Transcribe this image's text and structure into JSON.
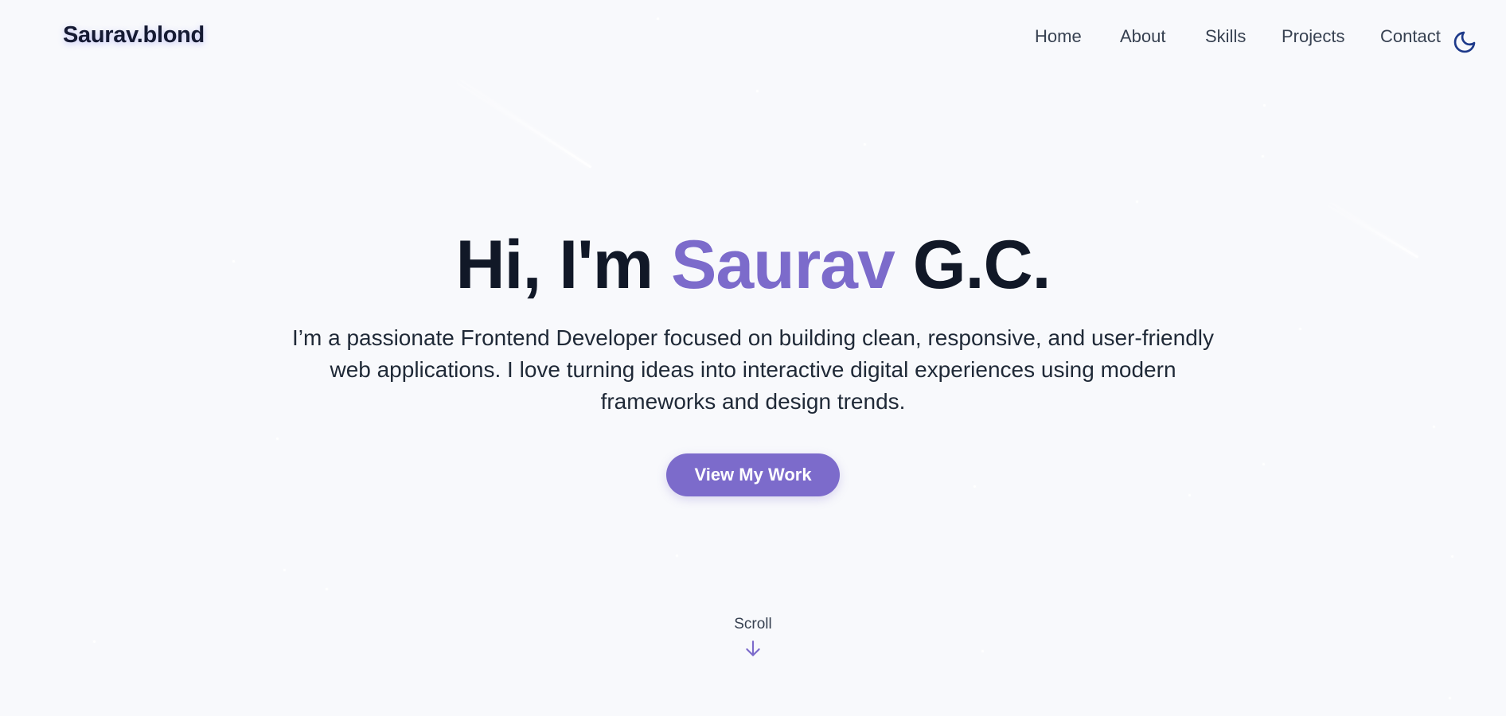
{
  "header": {
    "logo": "Saurav.blond",
    "nav": [
      {
        "label": "Home"
      },
      {
        "label": "About"
      },
      {
        "label": "Skills"
      },
      {
        "label": "Projects"
      },
      {
        "label": "Contact"
      }
    ],
    "theme_toggle_icon": "moon-icon"
  },
  "hero": {
    "title_prefix": "Hi, I'm",
    "title_accent": "Saurav",
    "title_suffix": "G.C.",
    "description": "I’m a passionate Frontend Developer focused on building clean, responsive, and user-friendly web applications. I love turning ideas into interactive digital experiences using modern frameworks and design trends.",
    "cta_label": "View My Work"
  },
  "scroll": {
    "label": "Scroll",
    "icon": "arrow-down-icon"
  },
  "colors": {
    "accent": "#7c6bcb",
    "background": "#f8f9fc",
    "text": "#111827",
    "moon": "#1e3a8a"
  }
}
